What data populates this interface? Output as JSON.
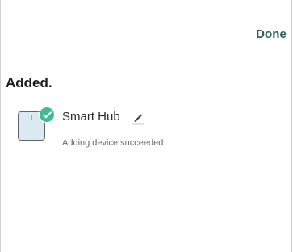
{
  "header": {
    "done_label": "Done"
  },
  "page": {
    "title": "Added."
  },
  "device": {
    "name": "Smart Hub",
    "status": "Adding device succeeded.",
    "thumbnail_icon": "smart-hub-icon",
    "badge_icon": "checkmark-icon",
    "edit_icon": "pencil-icon"
  },
  "colors": {
    "accent": "#2d5f5b",
    "success": "#3fbc95",
    "thumbnail_fill": "#dbe9f1"
  }
}
